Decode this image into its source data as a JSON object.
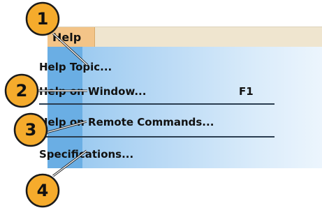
{
  "menubar": {
    "help_label": "Help"
  },
  "menu": {
    "items": [
      {
        "label": "Help Topic...",
        "shortcut": ""
      },
      {
        "label": "Help on Window...",
        "shortcut": "F1"
      },
      {
        "label": "Help on Remote Commands...",
        "shortcut": ""
      },
      {
        "label": "Specifications...",
        "shortcut": ""
      }
    ]
  },
  "callouts": [
    "1",
    "2",
    "3",
    "4"
  ],
  "colors": {
    "callout_fill": "#f5ab2c",
    "callout_stroke": "#1a1a1a",
    "menu_stripe": "#6aaee4",
    "menubar_highlight": "#f3c488"
  }
}
